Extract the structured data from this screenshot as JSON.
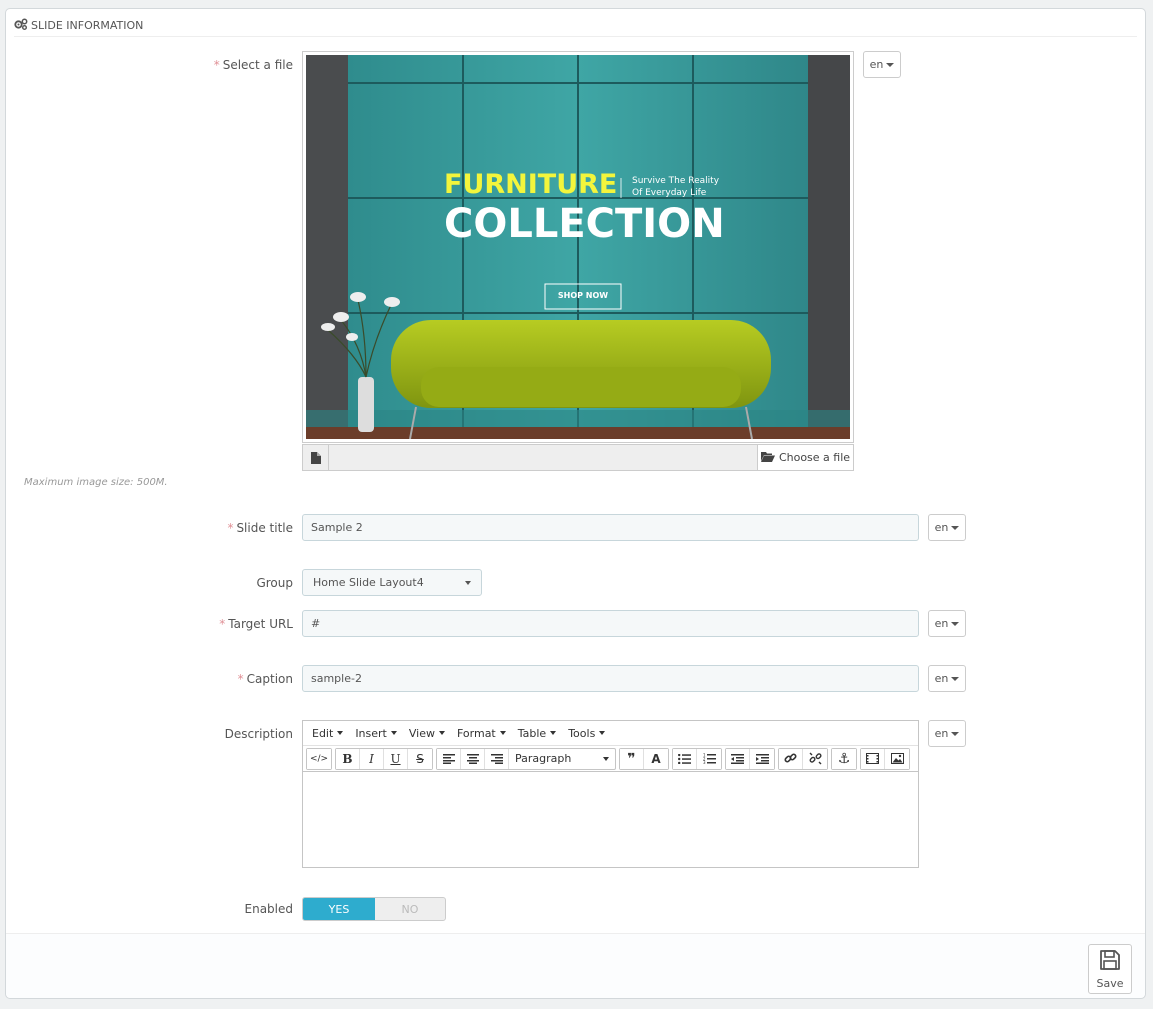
{
  "panel": {
    "title": "SLIDE INFORMATION",
    "title_icon": "cogs-icon"
  },
  "fields": {
    "file": {
      "label": "Select a file",
      "lang": "en",
      "choose_label": "Choose a file",
      "help": "Maximum image size: 500M."
    },
    "slide_title": {
      "label": "Slide title",
      "value": "Sample 2",
      "lang": "en"
    },
    "group": {
      "label": "Group",
      "value": "Home Slide Layout4"
    },
    "target_url": {
      "label": "Target URL",
      "value": "#",
      "lang": "en"
    },
    "caption": {
      "label": "Caption",
      "value": "sample-2",
      "lang": "en"
    },
    "description": {
      "label": "Description",
      "lang": "en"
    },
    "enabled": {
      "label": "Enabled",
      "yes": "YES",
      "no": "NO",
      "value": true
    }
  },
  "slide_image": {
    "headline_1": "FURNITURE",
    "headline_2": "COLLECTION",
    "tagline_1": "Survive The Reality",
    "tagline_2": "Of Everyday Life",
    "button": "SHOP NOW",
    "colors": {
      "wall": "#3d9e9e",
      "sofa": "#a4bb1a",
      "headline_accent": "#f3f53c"
    }
  },
  "editor": {
    "menus": [
      "Edit",
      "Insert",
      "View",
      "Format",
      "Table",
      "Tools"
    ],
    "block_format": "Paragraph"
  },
  "footer": {
    "save_label": "Save"
  },
  "colors": {
    "accent": "#2eacce",
    "required": "#e08f95"
  }
}
